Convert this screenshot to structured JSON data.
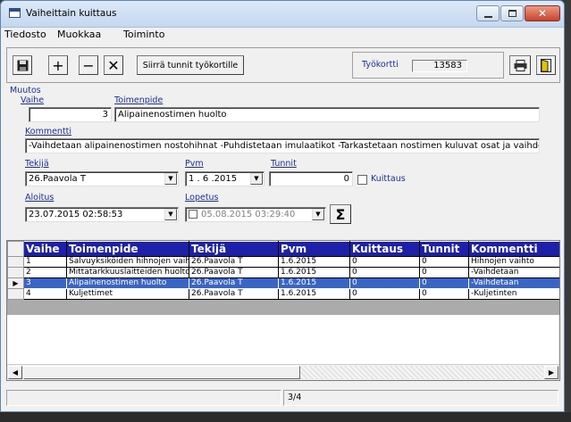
{
  "window": {
    "title": "Vaiheittain kuittaus"
  },
  "menu": [
    "Tiedosto",
    "Muokkaa",
    "Toiminto"
  ],
  "toolbar": {
    "save_icon": "save-icon",
    "add_icon": "plus-icon",
    "remove_icon": "minus-icon",
    "delete_icon": "x-icon",
    "transfer_label": "Siirrä tunnit työkortille",
    "tyokortti_label": "Työkortti",
    "tyokortti_value": "13583",
    "print_icon": "printer-icon",
    "exit_icon": "exit-door-icon"
  },
  "form": {
    "group_title": "Muutos",
    "vaihe_label": "Vaihe",
    "vaihe_value": "3",
    "toimenpide_label": "Toimenpide",
    "toimenpide_value": "Alipainenostimen huolto",
    "kommentti_label": "Kommentti",
    "kommentti_value": "-Vaihdetaan alipainenostimen nostohihnat -Puhdistetaan imulaatikot -Tarkastetaan nostimen kuluvat osat ja vaihdetaan",
    "tekija_label": "Tekijä",
    "tekija_value": "26.Paavola T",
    "pvm_label": "Pvm",
    "pvm_value": "1 . 6 .2015",
    "tunnit_label": "Tunnit",
    "tunnit_value": "0",
    "kuittaus_label": "Kuittaus",
    "aloitus_label": "Aloitus",
    "aloitus_value": "23.07.2015 02:58:53",
    "lopetus_label": "Lopetus",
    "lopetus_value": "05.08.2015 03:29:40",
    "sigma_icon": "sigma-icon"
  },
  "grid": {
    "columns": [
      "Vaihe",
      "Toimenpide",
      "Tekijä",
      "Pvm",
      "Kuittaus",
      "Tunnit",
      "Kommentti"
    ],
    "rows": [
      {
        "vaihe": "1",
        "toimenpide": "Salvuyksiköiden hihnojen vaihto",
        "tekija": "26.Paavola T",
        "pvm": "1.6.2015",
        "kuittaus": "0",
        "tunnit": "0",
        "kommentti": "Hihnojen vaihto"
      },
      {
        "vaihe": "2",
        "toimenpide": "Mittatarkkuuslaitteiden huolto",
        "tekija": "26.Paavola T",
        "pvm": "1.6.2015",
        "kuittaus": "0",
        "tunnit": "0",
        "kommentti": "-Vaihdetaan"
      },
      {
        "vaihe": "3",
        "toimenpide": "Alipainenostimen huolto",
        "tekija": "26.Paavola T",
        "pvm": "1.6.2015",
        "kuittaus": "0",
        "tunnit": "0",
        "kommentti": "-Vaihdetaan"
      },
      {
        "vaihe": "4",
        "toimenpide": "Kuljettimet",
        "tekija": "26.Paavola T",
        "pvm": "1.6.2015",
        "kuittaus": "0",
        "tunnit": "0",
        "kommentti": "-Kuljetinten"
      }
    ],
    "selected_row": 3,
    "row_indicator": "▶"
  },
  "status": {
    "record": "3/4"
  },
  "colors": {
    "grid_header": "#1d20a8",
    "selected_row": "#3a65c8",
    "label": "#1d2f9a"
  }
}
